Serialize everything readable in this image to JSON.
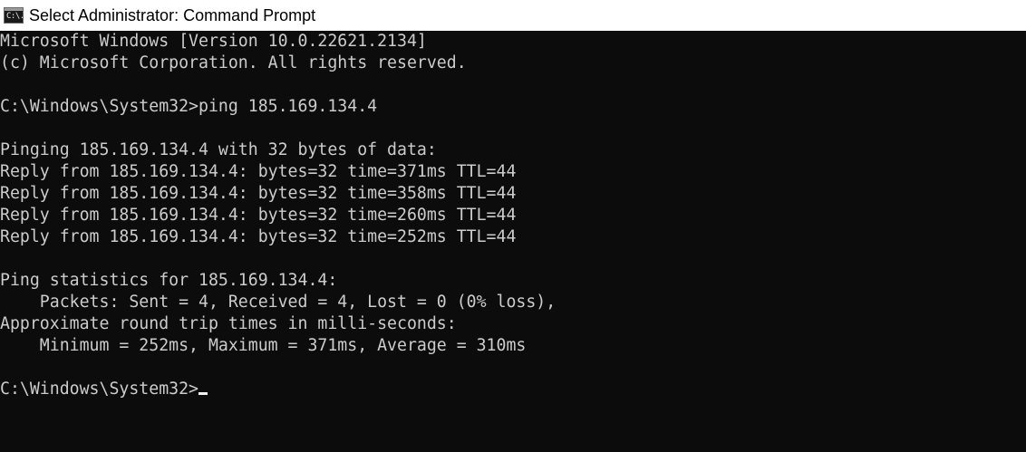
{
  "window": {
    "title": "Select Administrator: Command Prompt",
    "icon": "cmd-icon",
    "icon_glyph": "C:\\."
  },
  "console": {
    "lines": [
      "Microsoft Windows [Version 10.0.22621.2134]",
      "(c) Microsoft Corporation. All rights reserved.",
      "",
      "C:\\Windows\\System32>ping 185.169.134.4",
      "",
      "Pinging 185.169.134.4 with 32 bytes of data:",
      "Reply from 185.169.134.4: bytes=32 time=371ms TTL=44",
      "Reply from 185.169.134.4: bytes=32 time=358ms TTL=44",
      "Reply from 185.169.134.4: bytes=32 time=260ms TTL=44",
      "Reply from 185.169.134.4: bytes=32 time=252ms TTL=44",
      "",
      "Ping statistics for 185.169.134.4:",
      "    Packets: Sent = 4, Received = 4, Lost = 0 (0% loss),",
      "Approximate round trip times in milli-seconds:",
      "    Minimum = 252ms, Maximum = 371ms, Average = 310ms",
      "",
      "C:\\Windows\\System32>"
    ]
  },
  "colors": {
    "background": "#0c0c0c",
    "text": "#cccccc",
    "titlebar": "#ffffff"
  }
}
